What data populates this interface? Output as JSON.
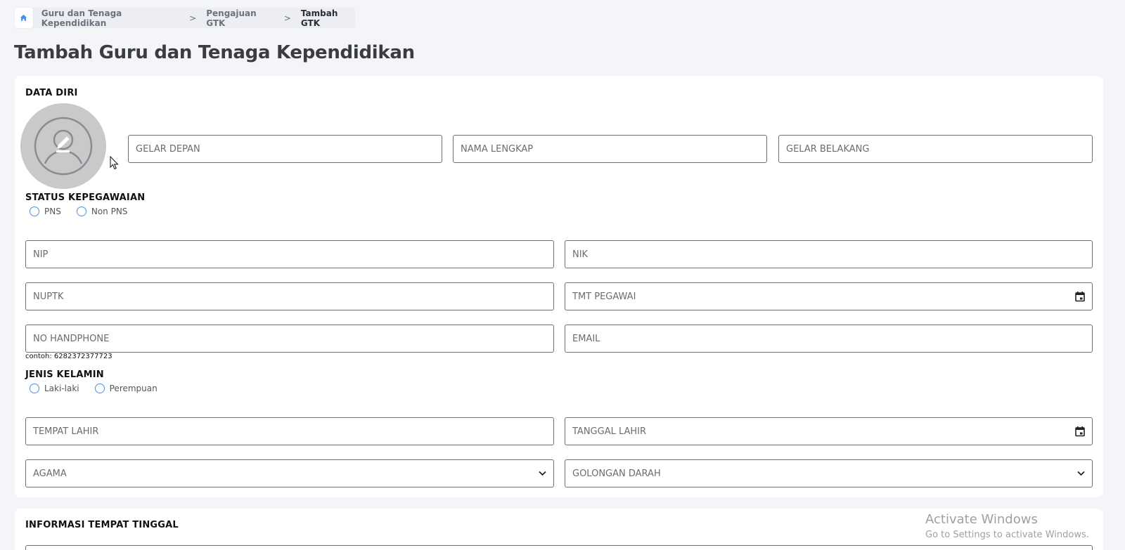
{
  "breadcrumb": {
    "home_icon": "home-icon",
    "items": [
      "Guru dan Tenaga Kependidikan",
      "Pengajuan GTK",
      "Tambah GTK"
    ],
    "separator": ">"
  },
  "page_title": "Tambah Guru dan Tenaga Kependidikan",
  "data_diri": {
    "section_label": "DATA DIRI",
    "avatar_icon": "user-edit-icon",
    "gelar_depan": "GELAR DEPAN",
    "nama_lengkap": "NAMA LENGKAP",
    "gelar_belakang": "GELAR BELAKANG",
    "status_label": "STATUS KEPEGAWAIAN",
    "status_options": [
      "PNS",
      "Non PNS"
    ],
    "nip": "NIP",
    "nik": "NIK",
    "nuptk": "NUPTK",
    "tmt_pegawai": "TMT PEGAWAI",
    "no_handphone": "NO HANDPHONE",
    "email": "EMAIL",
    "phone_hint": "contoh: 6282372377723",
    "gender_label": "JENIS KELAMIN",
    "gender_options": [
      "Laki-laki",
      "Perempuan"
    ],
    "tempat_lahir": "TEMPAT LAHIR",
    "tanggal_lahir": "TANGGAL LAHIR",
    "agama": "AGAMA",
    "golongan_darah": "GOLONGAN DARAH"
  },
  "tempat_tinggal": {
    "section_label": "INFORMASI TEMPAT TINGGAL"
  },
  "watermark": {
    "title": "Activate Windows",
    "subtitle": "Go to Settings to activate Windows."
  },
  "colors": {
    "accent": "#4a90e2",
    "background": "#f4f5f9",
    "avatar_bg": "#c9c9c9"
  }
}
